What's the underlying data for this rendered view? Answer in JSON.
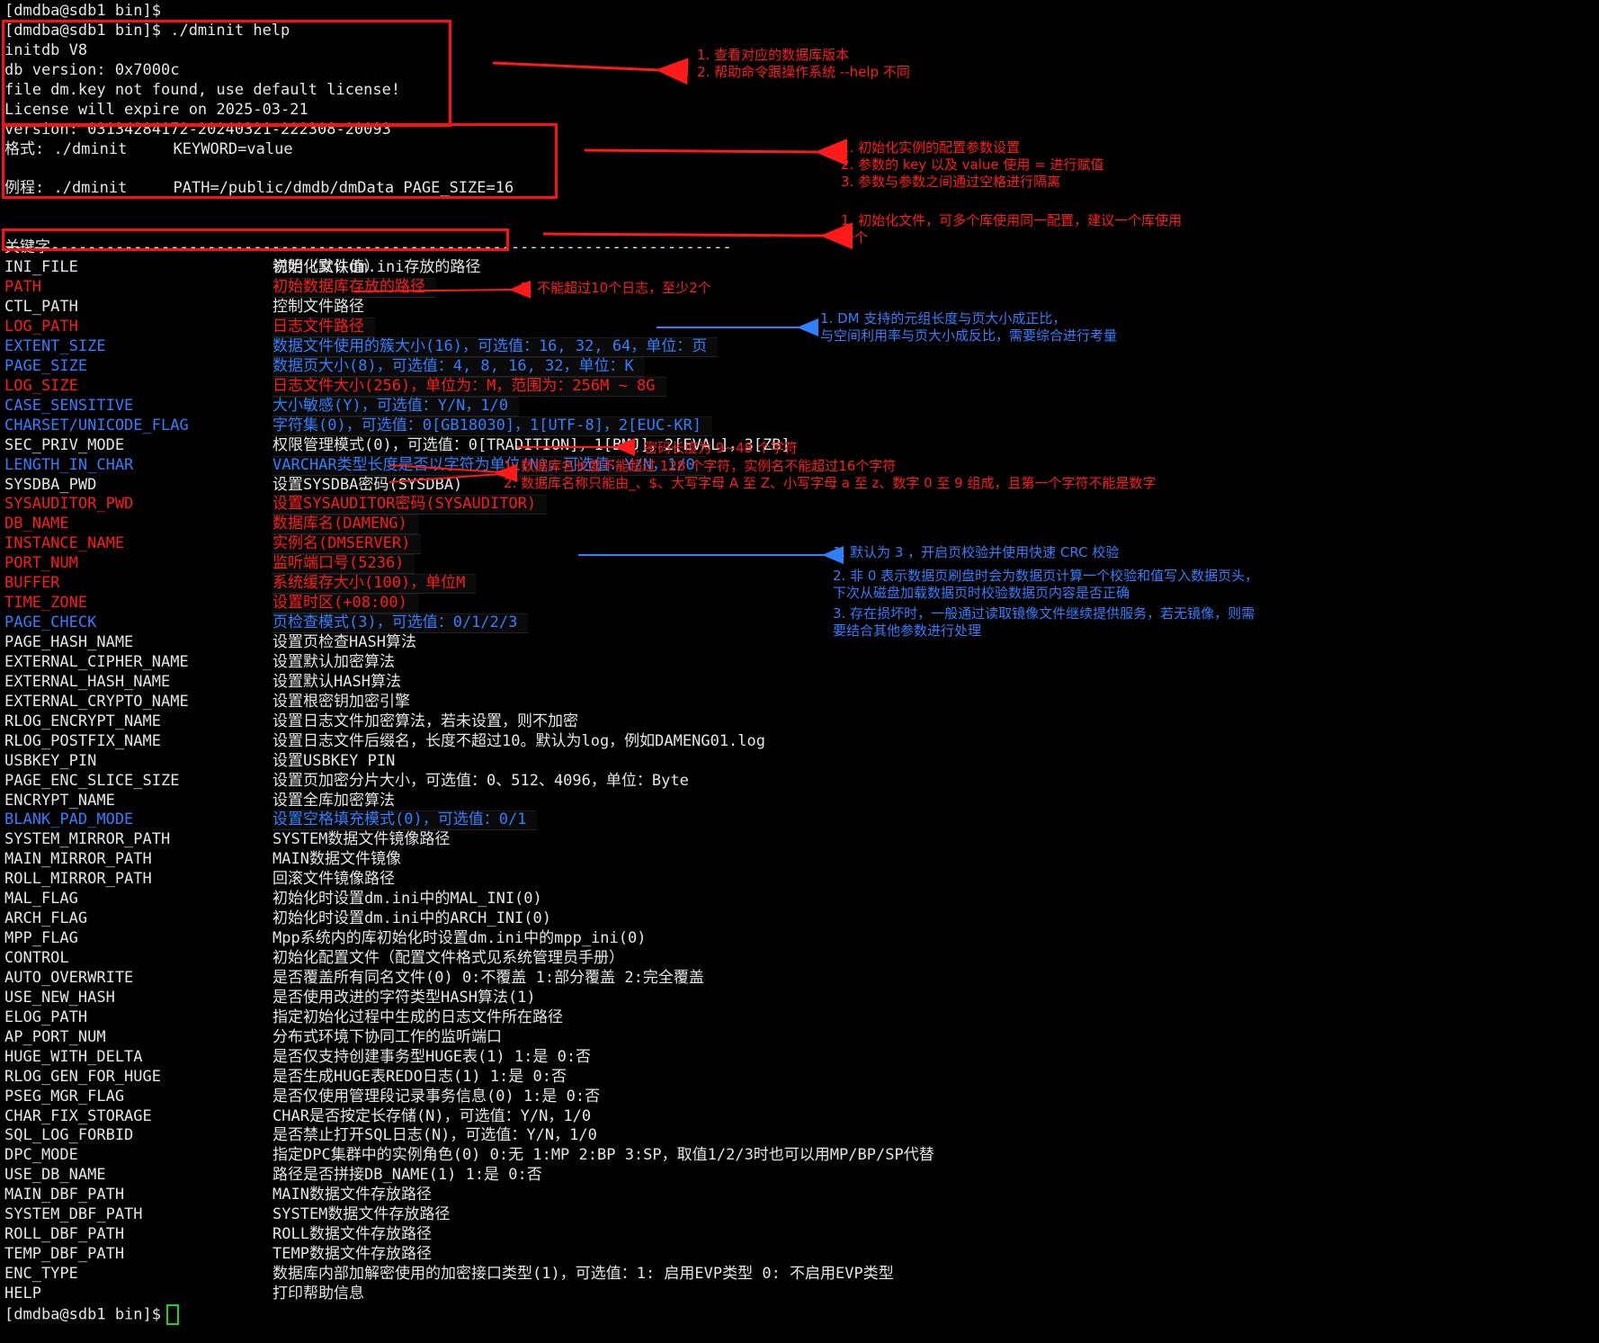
{
  "terminal": {
    "prompt_line": "[dmdba@sdb1 bin]$",
    "command_line": "[dmdba@sdb1 bin]$ ./dminit help",
    "header_lines": [
      "initdb V8",
      "db version: 0x7000c",
      "file dm.key not found, use default license!",
      "License will expire on 2025-03-21",
      "version: 03134284172-20240321-222308-20093"
    ],
    "format_line": "格式: ./dminit     KEYWORD=value",
    "example_line": "例程: ./dminit     PATH=/public/dmdb/dmData PAGE_SIZE=16",
    "table_header": {
      "key": "关键字",
      "desc": "说明（默认值）"
    },
    "separator": "-------------------------------------------------------------------------------",
    "params": [
      {
        "key": "INI_FILE",
        "desc": "初始化文件dm.ini存放的路径",
        "color": "white"
      },
      {
        "key": "PATH",
        "desc": "初始数据库存放的路径",
        "color": "red"
      },
      {
        "key": "CTL_PATH",
        "desc": "控制文件路径",
        "color": "white"
      },
      {
        "key": "LOG_PATH",
        "desc": "日志文件路径",
        "color": "red"
      },
      {
        "key": "EXTENT_SIZE",
        "desc": "数据文件使用的簇大小(16)，可选值：16, 32, 64，单位：页",
        "color": "blue"
      },
      {
        "key": "PAGE_SIZE",
        "desc": "数据页大小(8)，可选值：4, 8, 16, 32，单位：K",
        "color": "blue"
      },
      {
        "key": "LOG_SIZE",
        "desc": "日志文件大小(256)，单位为：M，范围为：256M ~ 8G",
        "color": "red"
      },
      {
        "key": "CASE_SENSITIVE",
        "desc": "大小敏感(Y)，可选值：Y/N，1/0",
        "color": "blue"
      },
      {
        "key": "CHARSET/UNICODE_FLAG",
        "desc": "字符集(0)，可选值：0[GB18030]，1[UTF-8]，2[EUC-KR]",
        "color": "blue"
      },
      {
        "key": "SEC_PRIV_MODE",
        "desc": "权限管理模式(0)，可选值：0[TRADITION]，1[BMJ]，2[EVAL]，3[ZB]",
        "color": "white"
      },
      {
        "key": "LENGTH_IN_CHAR",
        "desc": "VARCHAR类型长度是否以字符为单位(N)，可选值：Y/N，1/0",
        "color": "blue"
      },
      {
        "key": "SYSDBA_PWD",
        "desc": "设置SYSDBA密码(SYSDBA)",
        "color": "white"
      },
      {
        "key": "SYSAUDITOR_PWD",
        "desc": "设置SYSAUDITOR密码(SYSAUDITOR)",
        "color": "red"
      },
      {
        "key": "DB_NAME",
        "desc": "数据库名(DAMENG)",
        "color": "red"
      },
      {
        "key": "INSTANCE_NAME",
        "desc": "实例名(DMSERVER)",
        "color": "red"
      },
      {
        "key": "PORT_NUM",
        "desc": "监听端口号(5236)",
        "color": "red"
      },
      {
        "key": "BUFFER",
        "desc": "系统缓存大小(100)，单位M",
        "color": "red"
      },
      {
        "key": "TIME_ZONE",
        "desc": "设置时区(+08:00)",
        "color": "red"
      },
      {
        "key": "PAGE_CHECK",
        "desc": "页检查模式(3)，可选值：0/1/2/3",
        "color": "blue"
      },
      {
        "key": "PAGE_HASH_NAME",
        "desc": "设置页检查HASH算法",
        "color": "white"
      },
      {
        "key": "EXTERNAL_CIPHER_NAME",
        "desc": "设置默认加密算法",
        "color": "white"
      },
      {
        "key": "EXTERNAL_HASH_NAME",
        "desc": "设置默认HASH算法",
        "color": "white"
      },
      {
        "key": "EXTERNAL_CRYPTO_NAME",
        "desc": "设置根密钥加密引擎",
        "color": "white"
      },
      {
        "key": "RLOG_ENCRYPT_NAME",
        "desc": "设置日志文件加密算法，若未设置，则不加密",
        "color": "white"
      },
      {
        "key": "RLOG_POSTFIX_NAME",
        "desc": "设置日志文件后缀名，长度不超过10。默认为log，例如DAMENG01.log",
        "color": "white"
      },
      {
        "key": "USBKEY_PIN",
        "desc": "设置USBKEY PIN",
        "color": "white"
      },
      {
        "key": "PAGE_ENC_SLICE_SIZE",
        "desc": "设置页加密分片大小，可选值：0、512、4096，单位：Byte",
        "color": "white"
      },
      {
        "key": "ENCRYPT_NAME",
        "desc": "设置全库加密算法",
        "color": "white"
      },
      {
        "key": "BLANK_PAD_MODE",
        "desc": "设置空格填充模式(0)，可选值：0/1",
        "color": "blue"
      },
      {
        "key": "SYSTEM_MIRROR_PATH",
        "desc": "SYSTEM数据文件镜像路径",
        "color": "white"
      },
      {
        "key": "MAIN_MIRROR_PATH",
        "desc": "MAIN数据文件镜像",
        "color": "white"
      },
      {
        "key": "ROLL_MIRROR_PATH",
        "desc": "回滚文件镜像路径",
        "color": "white"
      },
      {
        "key": "MAL_FLAG",
        "desc": "初始化时设置dm.ini中的MAL_INI(0)",
        "color": "white"
      },
      {
        "key": "ARCH_FLAG",
        "desc": "初始化时设置dm.ini中的ARCH_INI(0)",
        "color": "white"
      },
      {
        "key": "MPP_FLAG",
        "desc": "Mpp系统内的库初始化时设置dm.ini中的mpp_ini(0)",
        "color": "white"
      },
      {
        "key": "CONTROL",
        "desc": "初始化配置文件（配置文件格式见系统管理员手册）",
        "color": "white"
      },
      {
        "key": "AUTO_OVERWRITE",
        "desc": "是否覆盖所有同名文件(0) 0:不覆盖 1:部分覆盖 2:完全覆盖",
        "color": "white"
      },
      {
        "key": "USE_NEW_HASH",
        "desc": "是否使用改进的字符类型HASH算法(1)",
        "color": "white"
      },
      {
        "key": "ELOG_PATH",
        "desc": "指定初始化过程中生成的日志文件所在路径",
        "color": "white"
      },
      {
        "key": "AP_PORT_NUM",
        "desc": "分布式环境下协同工作的监听端口",
        "color": "white"
      },
      {
        "key": "HUGE_WITH_DELTA",
        "desc": "是否仅支持创建事务型HUGE表(1) 1:是 0:否",
        "color": "white"
      },
      {
        "key": "RLOG_GEN_FOR_HUGE",
        "desc": "是否生成HUGE表REDO日志(1) 1:是 0:否",
        "color": "white"
      },
      {
        "key": "PSEG_MGR_FLAG",
        "desc": "是否仅使用管理段记录事务信息(0) 1:是 0:否",
        "color": "white"
      },
      {
        "key": "CHAR_FIX_STORAGE",
        "desc": "CHAR是否按定长存储(N)，可选值：Y/N，1/0",
        "color": "white"
      },
      {
        "key": "SQL_LOG_FORBID",
        "desc": "是否禁止打开SQL日志(N)，可选值：Y/N，1/0",
        "color": "white"
      },
      {
        "key": "DPC_MODE",
        "desc": "指定DPC集群中的实例角色(0) 0:无 1:MP 2:BP 3:SP，取值1/2/3时也可以用MP/BP/SP代替",
        "color": "white"
      },
      {
        "key": "USE_DB_NAME",
        "desc": "路径是否拼接DB_NAME(1) 1:是 0:否",
        "color": "white"
      },
      {
        "key": "MAIN_DBF_PATH",
        "desc": "MAIN数据文件存放路径",
        "color": "white"
      },
      {
        "key": "SYSTEM_DBF_PATH",
        "desc": "SYSTEM数据文件存放路径",
        "color": "white"
      },
      {
        "key": "ROLL_DBF_PATH",
        "desc": "ROLL数据文件存放路径",
        "color": "white"
      },
      {
        "key": "TEMP_DBF_PATH",
        "desc": "TEMP数据文件存放路径",
        "color": "white"
      },
      {
        "key": "ENC_TYPE",
        "desc": "数据库内部加解密使用的加密接口类型(1)，可选值：1: 启用EVP类型 0: 不启用EVP类型",
        "color": "white"
      },
      {
        "key": "HELP",
        "desc": "打印帮助信息",
        "color": "white"
      }
    ],
    "final_prompt": "[dmdba@sdb1 bin]$"
  },
  "annotations": {
    "version_note": "1. 查看对应的数据库版本\n2. 帮助命令跟操作系统 --help 不同",
    "format_note": "1. 初始化实例的配置参数设置\n2. 参数的 key 以及 value 使用 = 进行赋值\n3. 参数与参数之间通过空格进行隔离",
    "ini_note": "1. 初始化文件，可多个库使用同一配置，建议一个库使用\n一个",
    "log_path_note": "1. 不能超过10个日志，至少2个",
    "page_size_note": "1. DM 支持的元组长度与页大小成正比，\n与空间利用率与页大小成反比，需要综合进行考量",
    "pwd_note": "1. 密码长度为 9~48 个字符",
    "db_name_note": "1. 数据库名长度不能超过 128 个字符，实例名不能超过16个字符\n2. 数据库名称只能由_、$、大写字母 A 至 Z、小写字母 a 至 z、数字 0 至 9 组成，且第一个字符不能是数字",
    "page_check_note": "1. 默认为 3 ，开启页校验并使用快速 CRC 校验",
    "page_check_note2": "2. 非 0 表示数据页刷盘时会为数据页计算一个校验和值写入数据页头，\n下次从磁盘加载数据页时校验数据页内容是否正确",
    "page_check_note3": "3. 存在损坏时，一般通过读取镜像文件继续提供服务，若无镜像，则需\n要结合其他参数进行处理"
  },
  "colors": {
    "background": "#000000",
    "text": "#e6e6e6",
    "red": "#ff1a1a",
    "blue": "#2f7fff",
    "cursor": "#1fd21f"
  }
}
